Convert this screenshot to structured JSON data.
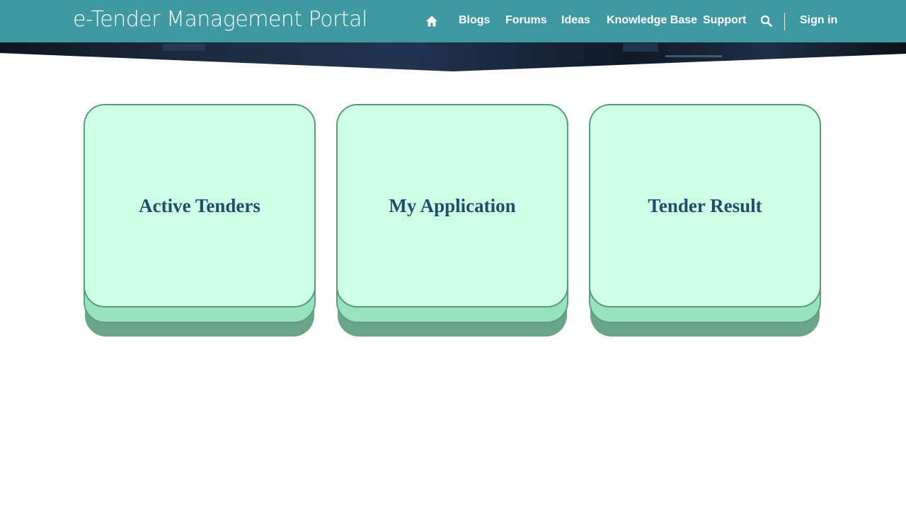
{
  "header": {
    "brand": "e-Tender Management Portal",
    "nav": [
      {
        "label": "Blogs"
      },
      {
        "label": "Forums"
      },
      {
        "label": "Ideas"
      },
      {
        "label": "Knowledge Base"
      },
      {
        "label": "Support"
      }
    ],
    "sign_in": "Sign in",
    "icons": {
      "home": "home-icon",
      "search": "search-icon"
    },
    "colors": {
      "bar": "#3e9aa0",
      "text": "#ffffff"
    }
  },
  "tiles": [
    {
      "label": "Active Tenders"
    },
    {
      "label": "My Application"
    },
    {
      "label": "Tender Result"
    }
  ],
  "colors": {
    "tile_face": "#cefee6",
    "tile_edge": "#96e3bd",
    "tile_shadow": "#6aa489",
    "tile_text": "#1f4e6a"
  }
}
